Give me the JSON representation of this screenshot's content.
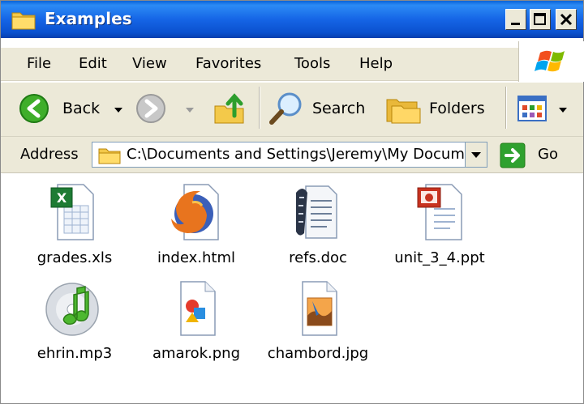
{
  "window": {
    "title": "Examples"
  },
  "menu": [
    "File",
    "Edit",
    "View",
    "Favorites",
    "Tools",
    "Help"
  ],
  "toolbar": {
    "back_label": "Back",
    "search_label": "Search",
    "folders_label": "Folders"
  },
  "address": {
    "label": "Address",
    "path": "C:\\Documents and Settings\\Jeremy\\My Documents\\Examples",
    "go_label": "Go"
  },
  "files": [
    {
      "name": "grades.xls",
      "icon": "excel-file-icon"
    },
    {
      "name": "index.html",
      "icon": "firefox-html-icon"
    },
    {
      "name": "refs.doc",
      "icon": "document-file-icon"
    },
    {
      "name": "unit_3_4.ppt",
      "icon": "powerpoint-file-icon"
    },
    {
      "name": "ehrin.mp3",
      "icon": "itunes-music-icon"
    },
    {
      "name": "amarok.png",
      "icon": "png-image-icon"
    },
    {
      "name": "chambord.jpg",
      "icon": "jpg-image-icon"
    }
  ],
  "colors": {
    "titlebar": "#0b51cf",
    "chrome": "#ece9d8",
    "go_green": "#2fa12f"
  }
}
